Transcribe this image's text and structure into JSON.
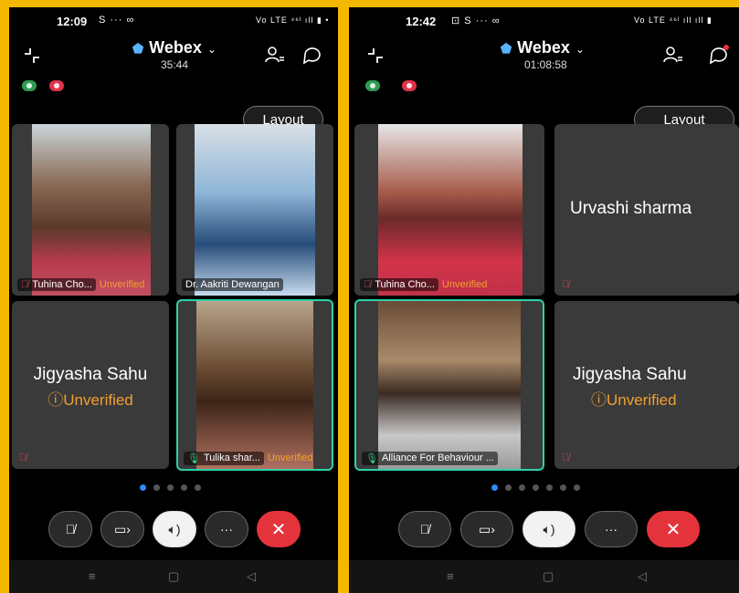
{
  "left": {
    "status_time": "12:09",
    "status_icons": "S ··· ∞",
    "status_right": "Vo LTE ⁴⁶ˡ ıll ▮ •",
    "app_title": "Webex",
    "call_timer": "35:44",
    "layout_label": "Layout",
    "tiles": [
      {
        "name": "Tuhina Cho...",
        "unverified": "Unverified"
      },
      {
        "name": "Dr. Aakriti Dewangan"
      },
      {
        "name": "Jigyasha Sahu",
        "unverified": "Unverified"
      },
      {
        "name": "Tulika shar...",
        "unverified": "Unverified"
      }
    ]
  },
  "right": {
    "status_time": "12:42",
    "status_icons": "⊡ S ··· ∞",
    "status_right": "Vo LTE ⁴⁶ˡ ıll ıll ▮",
    "app_title": "Webex",
    "call_timer": "01:08:58",
    "layout_label": "Layout",
    "tiles": [
      {
        "name": "Tuhina Cho...",
        "unverified": "Unverified"
      },
      {
        "name": "Urvashi sharma"
      },
      {
        "name": "Alliance For Behaviour ..."
      },
      {
        "name": "Jigyasha Sahu",
        "unverified": "Unverified"
      }
    ]
  },
  "icons": {
    "shield": "shield-icon",
    "mic_off": "mic-off-icon",
    "camera": "camera-icon",
    "speaker": "speaker-icon",
    "more": "more-icon",
    "end": "end-call-icon"
  },
  "colors": {
    "accent_blue": "#2d8cff",
    "end_red": "#e5333b",
    "unverified_orange": "#f0a030",
    "active_border": "#2fd1a8",
    "frame_yellow": "#f5b800"
  },
  "pagination": {
    "total": 5,
    "current": 1
  },
  "right_pagination": {
    "total": 7,
    "current": 1
  }
}
